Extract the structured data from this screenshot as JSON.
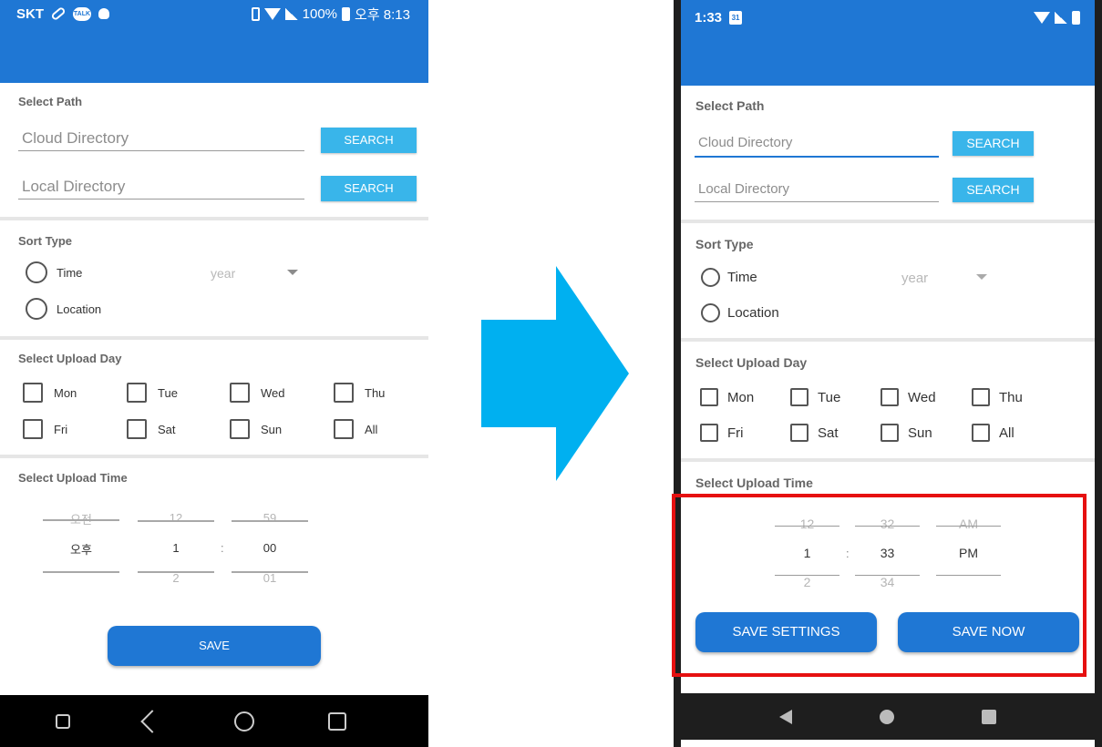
{
  "before": {
    "statusbar": {
      "carrier": "SKT",
      "talk_badge": "TALK",
      "battery": "100%",
      "time": "오후 8:13"
    },
    "path": {
      "label": "Select Path",
      "cloud_placeholder": "Cloud Directory",
      "local_placeholder": "Local Directory",
      "search_label": "SEARCH"
    },
    "sort": {
      "label": "Sort Type",
      "time": "Time",
      "location": "Location",
      "dropdown_value": "year"
    },
    "days": {
      "label": "Select Upload Day",
      "items": [
        "Mon",
        "Tue",
        "Wed",
        "Thu",
        "Fri",
        "Sat",
        "Sun",
        "All"
      ]
    },
    "time": {
      "label": "Select Upload Time",
      "ampm": {
        "prev": "오전",
        "current": "오후",
        "next": ""
      },
      "hour": {
        "prev": "12",
        "current": "1",
        "next": "2"
      },
      "minute": {
        "prev": "59",
        "current": "00",
        "next": "01"
      },
      "separator": ":"
    },
    "save_label": "SAVE"
  },
  "after": {
    "statusbar": {
      "time": "1:33",
      "calendar_badge": "31"
    },
    "path": {
      "label": "Select Path",
      "cloud_placeholder": "Cloud Directory",
      "local_placeholder": "Local Directory",
      "search_label": "SEARCH"
    },
    "sort": {
      "label": "Sort Type",
      "time": "Time",
      "location": "Location",
      "dropdown_value": "year"
    },
    "days": {
      "label": "Select Upload Day",
      "items": [
        "Mon",
        "Tue",
        "Wed",
        "Thu",
        "Fri",
        "Sat",
        "Sun",
        "All"
      ]
    },
    "time": {
      "label": "Select Upload Time",
      "hour": {
        "prev": "12",
        "current": "1",
        "next": "2"
      },
      "minute": {
        "prev": "32",
        "current": "33",
        "next": "34"
      },
      "ampm": {
        "prev": "AM",
        "current": "PM",
        "next": ""
      },
      "separator": ":"
    },
    "save_settings_label": "SAVE SETTINGS",
    "save_now_label": "SAVE NOW"
  },
  "colors": {
    "appbar": "#1f77d4",
    "search_button": "#39b5ea",
    "arrow": "#00b0f0",
    "highlight": "#e61010"
  }
}
